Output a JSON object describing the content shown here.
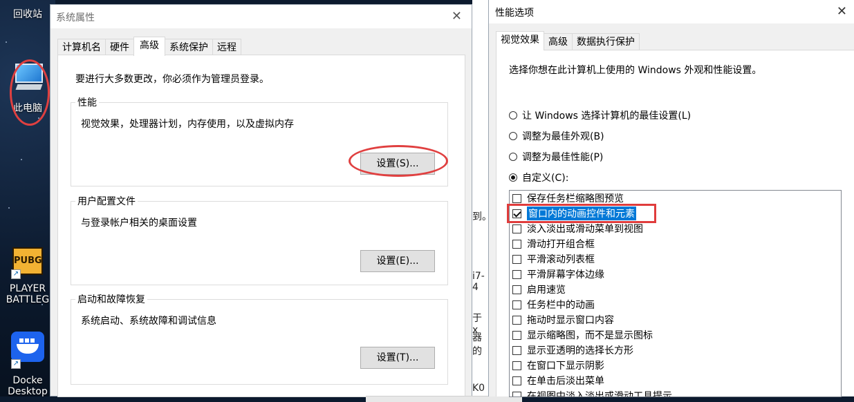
{
  "desktop": {
    "icons": [
      {
        "label": "回收站"
      },
      {
        "label": "此电脑"
      },
      {
        "label": "PLAYER"
      },
      {
        "label": "BATTLEG"
      },
      {
        "label": "Docke"
      },
      {
        "label": "Desktop"
      }
    ],
    "pubg_logo_text": "PUBG"
  },
  "background_text": [
    "到。",
    "i7-4",
    "于 x",
    "器的",
    "K0"
  ],
  "system_properties": {
    "title": "系统属性",
    "close_glyph": "✕",
    "tabs": [
      "计算机名",
      "硬件",
      "高级",
      "系统保护",
      "远程"
    ],
    "active_tab": "高级",
    "admin_note": "要进行大多数更改，你必须作为管理员登录。",
    "performance": {
      "legend": "性能",
      "desc": "视觉效果，处理器计划，内存使用，以及虚拟内存",
      "button": "设置(S)..."
    },
    "user_profiles": {
      "legend": "用户配置文件",
      "desc": "与登录帐户相关的桌面设置",
      "button": "设置(E)..."
    },
    "startup_recovery": {
      "legend": "启动和故障恢复",
      "desc": "系统启动、系统故障和调试信息",
      "button": "设置(T)..."
    }
  },
  "performance_options": {
    "title": "性能选项",
    "close_glyph": "✕",
    "tabs": [
      "视觉效果",
      "高级",
      "数据执行保护"
    ],
    "active_tab": "视觉效果",
    "intro": "选择你想在此计算机上使用的 Windows 外观和性能设置。",
    "radios": [
      {
        "label": "让 Windows 选择计算机的最佳设置(L)",
        "selected": false
      },
      {
        "label": "调整为最佳外观(B)",
        "selected": false
      },
      {
        "label": "调整为最佳性能(P)",
        "selected": false
      },
      {
        "label": "自定义(C):",
        "selected": true
      }
    ],
    "effects": [
      {
        "label": "保存任务栏缩略图预览",
        "checked": false
      },
      {
        "label": "窗口内的动画控件和元素",
        "checked": true,
        "highlighted": true
      },
      {
        "label": "淡入淡出或滑动菜单到视图",
        "checked": false
      },
      {
        "label": "滑动打开组合框",
        "checked": false
      },
      {
        "label": "平滑滚动列表框",
        "checked": false
      },
      {
        "label": "平滑屏幕字体边缘",
        "checked": false
      },
      {
        "label": "启用速览",
        "checked": false
      },
      {
        "label": "任务栏中的动画",
        "checked": false
      },
      {
        "label": "拖动时显示窗口内容",
        "checked": false
      },
      {
        "label": "显示缩略图，而不是显示图标",
        "checked": false
      },
      {
        "label": "显示亚透明的选择长方形",
        "checked": false
      },
      {
        "label": "在窗口下显示阴影",
        "checked": false
      },
      {
        "label": "在单击后淡出菜单",
        "checked": false
      },
      {
        "label": "在视图中淡入淡出或滑动工具提示",
        "checked": false
      }
    ]
  },
  "colors": {
    "annotation_red": "#e04040",
    "selection_blue": "#0078d7"
  }
}
